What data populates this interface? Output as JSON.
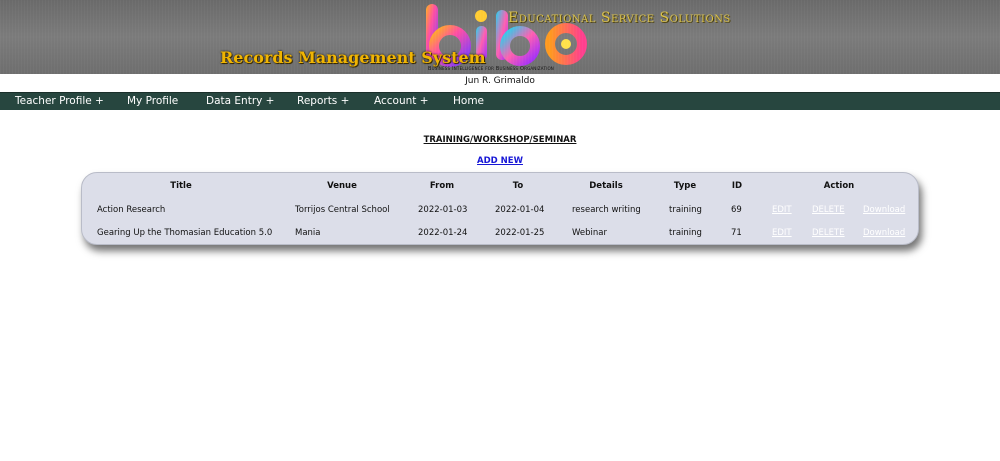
{
  "header": {
    "tagline": "Educational Service Solutions",
    "system_title": "Records Management System",
    "brand_sub": "Business Intelligence for Business Organization",
    "colors": {
      "gold": "#f0b400",
      "nav_bg": "#27463f",
      "table_bg": "#dcdee9",
      "link": "#1717d6"
    }
  },
  "user": {
    "name": "Jun R. Grimaldo"
  },
  "nav": {
    "items": [
      {
        "label": "Teacher Profile +"
      },
      {
        "label": "My Profile"
      },
      {
        "label": "Data Entry +"
      },
      {
        "label": "Reports +"
      },
      {
        "label": "Account +"
      },
      {
        "label": "Home"
      }
    ]
  },
  "page": {
    "heading": "TRAINING/WORKSHOP/SEMINAR",
    "add_new": "ADD NEW"
  },
  "table": {
    "columns": [
      "Title",
      "Venue",
      "From",
      "To",
      "Details",
      "Type",
      "ID",
      "Action"
    ],
    "rows": [
      {
        "title": "Action Research",
        "venue": "Torrijos Central School",
        "from": "2022-01-03",
        "to": "2022-01-04",
        "details": "research writing",
        "type": "training",
        "id": "69",
        "actions": [
          "EDIT",
          "DELETE",
          "Download"
        ]
      },
      {
        "title": "Gearing Up the Thomasian Education 5.0",
        "venue": "Mania",
        "from": "2022-01-24",
        "to": "2022-01-25",
        "details": "Webinar",
        "type": "training",
        "id": "71",
        "actions": [
          "EDIT",
          "DELETE",
          "Download"
        ]
      }
    ]
  }
}
